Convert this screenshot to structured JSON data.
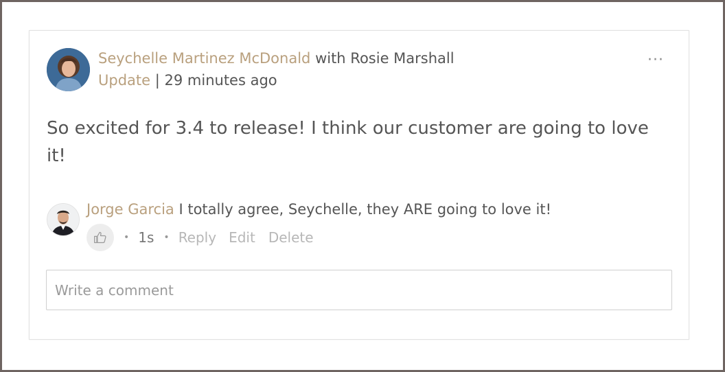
{
  "post": {
    "author": "Seychelle Martinez McDonald",
    "with_text": "with Rosie Marshall",
    "type": "Update",
    "separator": "|",
    "time_ago": "29 minutes ago",
    "more_menu": "···",
    "body": "So excited for 3.4 to release! I think our customer are going to love it!"
  },
  "comment": {
    "author": "Jorge Garcia",
    "text": "I totally agree, Seychelle, they ARE going to love it!",
    "time": "1s",
    "dot": "•",
    "reply_label": "Reply",
    "edit_label": "Edit",
    "delete_label": "Delete"
  },
  "composer": {
    "placeholder": "Write a comment"
  },
  "colors": {
    "link": "#b9a07e",
    "text": "#555555",
    "muted": "#b7b7b7"
  }
}
